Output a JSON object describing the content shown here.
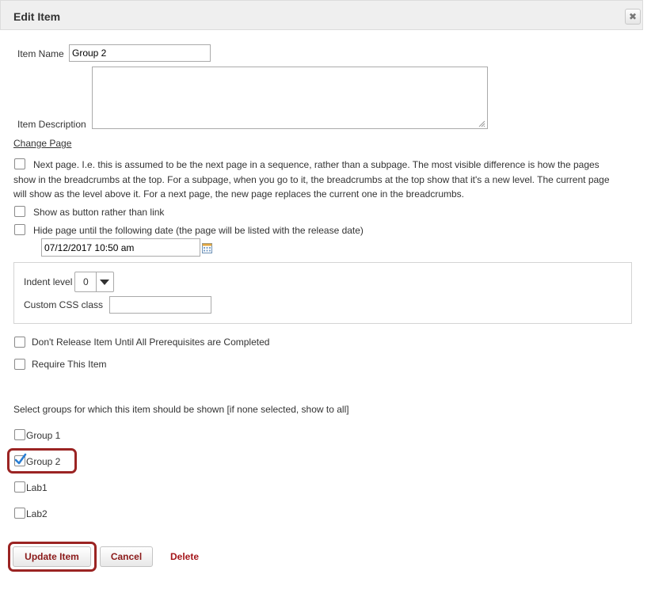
{
  "dialog": {
    "title": "Edit Item",
    "close_glyph": "✖"
  },
  "item_name": {
    "label": "Item Name",
    "value": "Group 2"
  },
  "item_description": {
    "label": "Item Description",
    "value": ""
  },
  "change_page_link": "Change Page",
  "options": {
    "next_page": "Next page. I.e. this is assumed to be the next page in a sequence, rather than a subpage. The most visible difference is how the pages show in the breadcrumbs at the top. For a subpage, when you go to it, the breadcrumbs at the top show that it's a new level. The current page will show as the level above it. For a next page, the new page replaces the current one in the breadcrumbs.",
    "show_as_button": "Show as button rather than link",
    "hide_page": "Hide page until the following date (the page will be listed with the release date)",
    "release_date": "07/12/2017 10:50 am"
  },
  "format": {
    "indent_label": "Indent level",
    "indent_value": "0",
    "css_label": "Custom CSS class",
    "css_value": ""
  },
  "prereq_label": "Don't Release Item Until All Prerequisites are Completed",
  "require_label": "Require This Item",
  "groups": {
    "heading": "Select groups for which this item should be shown [if none selected, show to all]",
    "items": [
      {
        "label": "Group 1",
        "checked": false
      },
      {
        "label": "Group 2",
        "checked": true
      },
      {
        "label": "Lab1",
        "checked": false
      },
      {
        "label": "Lab2",
        "checked": false
      }
    ]
  },
  "buttons": {
    "update": "Update Item",
    "cancel": "Cancel",
    "delete": "Delete"
  },
  "colors": {
    "highlight": "#9b2423",
    "button_text": "#8b1a1a",
    "checkmark": "#2a7fd4"
  }
}
